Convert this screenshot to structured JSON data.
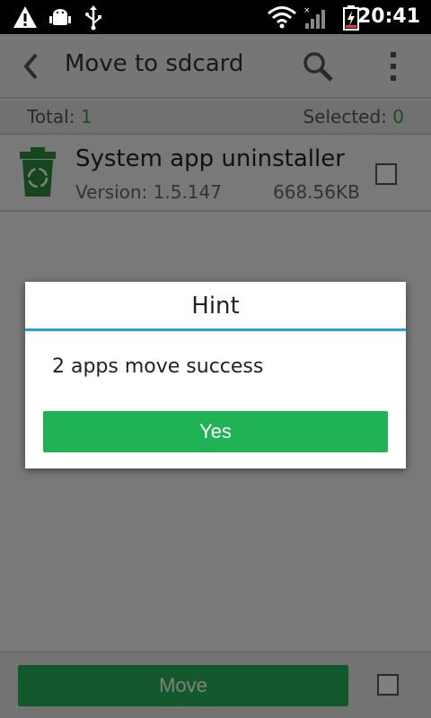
{
  "status_bar": {
    "time": "20:41",
    "icons": [
      "warning-icon",
      "android-debug-icon",
      "usb-icon",
      "wifi-icon",
      "signal-icon",
      "battery-charging-icon"
    ]
  },
  "action_bar": {
    "title": "Move to sdcard",
    "icons": [
      "back-icon",
      "search-icon",
      "overflow-menu-icon"
    ]
  },
  "summary": {
    "total_label": "Total: ",
    "total_value": "1",
    "selected_label": "Selected: ",
    "selected_value": "0"
  },
  "app_list": [
    {
      "name": "System app uninstaller",
      "version": "Version: 1.5.147",
      "size": "668.56KB",
      "checked": false,
      "icon": "recycle-trash-icon"
    }
  ],
  "bottom_bar": {
    "move_label": "Move",
    "select_all_checked": false
  },
  "dialog": {
    "title": "Hint",
    "message": "2 apps move success",
    "yes_label": "Yes"
  },
  "colors": {
    "accent_green": "#1fb355",
    "divider_blue": "#2aa0d8",
    "count_green": "#2ea043"
  }
}
